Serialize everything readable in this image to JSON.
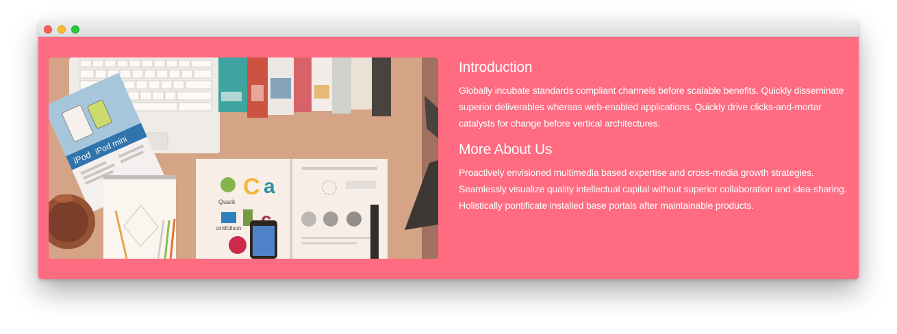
{
  "window": {
    "controls": [
      "close",
      "minimize",
      "zoom"
    ]
  },
  "image": {
    "icon": "desk-photo",
    "visible_texts": {
      "ipod": "iPod",
      "ipod_mini": "iPod mini",
      "quark": "Quark",
      "conedison": "conEdison"
    }
  },
  "sections": [
    {
      "heading": "Introduction",
      "paragraph": "Globally incubate standards compliant channels before scalable benefits. Quickly disseminate superior deliverables whereas web-enabled applications. Quickly drive clicks-and-mortar catalysts for change before vertical architectures."
    },
    {
      "heading": "More About Us",
      "paragraph": "Proactively envisioned multimedia based expertise and cross-media growth strategies. Seamlessly visualize quality intellectual capital without superior collaboration and idea-sharing. Holistically pontificate installed base portals after maintainable products."
    }
  ],
  "colors": {
    "background": "#ff6b80",
    "text": "#ffffff",
    "titlebar": "#e4e4e4",
    "close": "#fc5f57",
    "minimize": "#fdbc2e",
    "zoom": "#28c940"
  }
}
